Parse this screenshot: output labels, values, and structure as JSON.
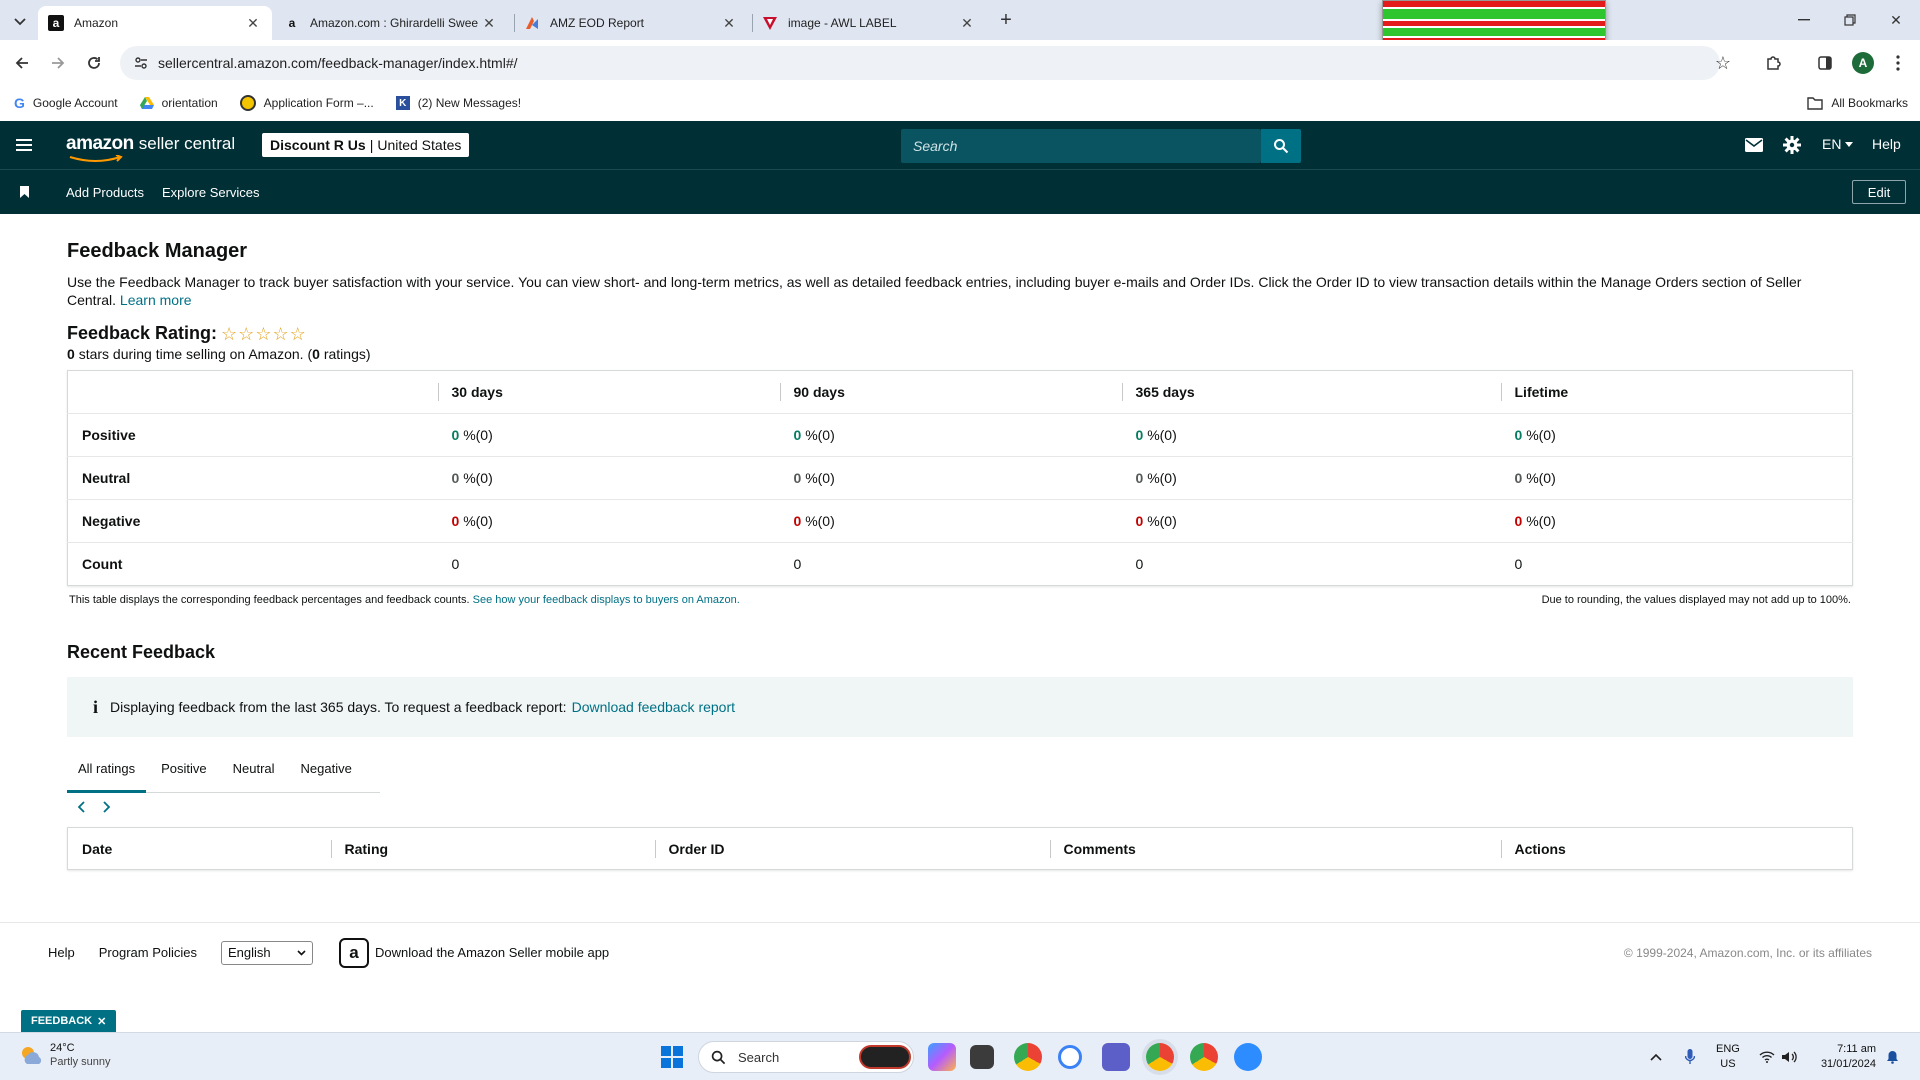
{
  "browser": {
    "tabs": [
      {
        "title": "Amazon",
        "active": true
      },
      {
        "title": "Amazon.com : Ghirardelli Swee"
      },
      {
        "title": "AMZ EOD Report"
      },
      {
        "title": "image - AWL LABEL"
      }
    ],
    "url": "sellercentral.amazon.com/feedback-manager/index.html#/",
    "bookmarks": [
      "Google Account",
      "orientation",
      "Application Form –...",
      "(2) New Messages!"
    ],
    "all_bookmarks": "All Bookmarks",
    "profile_initial": "A"
  },
  "header": {
    "logo_main": "amazon",
    "logo_sub": "seller central",
    "store_name": "Discount R Us",
    "store_region": "United States",
    "search_placeholder": "Search",
    "language": "EN",
    "help": "Help"
  },
  "nav": {
    "add_products": "Add Products",
    "explore_services": "Explore Services",
    "edit": "Edit"
  },
  "page": {
    "title": "Feedback Manager",
    "description": "Use the Feedback Manager to track buyer satisfaction with your service. You can view short- and long-term metrics, as well as detailed feedback entries, including buyer e-mails and Order IDs. Click the Order ID to view transaction details within the Manage Orders section of Seller Central.",
    "learn_more": "Learn more",
    "rating_label": "Feedback Rating:",
    "stars_count": "0",
    "stars_text": "stars during time selling on Amazon. (",
    "ratings_count": "0",
    "ratings_text": "ratings)"
  },
  "metrics": {
    "columns": [
      "30 days",
      "90 days",
      "365 days",
      "Lifetime"
    ],
    "rows": [
      {
        "label": "Positive",
        "values": [
          "0",
          "0",
          "0",
          "0"
        ],
        "suffix": "%(0)"
      },
      {
        "label": "Neutral",
        "values": [
          "0",
          "0",
          "0",
          "0"
        ],
        "suffix": "%(0)"
      },
      {
        "label": "Negative",
        "values": [
          "0",
          "0",
          "0",
          "0"
        ],
        "suffix": "%(0)"
      },
      {
        "label": "Count",
        "values": [
          "0",
          "0",
          "0",
          "0"
        ]
      }
    ],
    "note_left": "This table displays the corresponding feedback percentages and feedback counts.",
    "note_link": "See how your feedback displays to buyers on Amazon.",
    "note_right": "Due to rounding, the values displayed may not add up to 100%."
  },
  "recent": {
    "title": "Recent Feedback",
    "info_text": "Displaying feedback from the last 365 days. To request a feedback report:",
    "info_link": "Download feedback report",
    "tabs": [
      "All ratings",
      "Positive",
      "Neutral",
      "Negative"
    ],
    "columns": [
      "Date",
      "Rating",
      "Order ID",
      "Comments",
      "Actions"
    ]
  },
  "footer": {
    "help": "Help",
    "policies": "Program Policies",
    "language": "English",
    "app": "Download the Amazon Seller mobile app",
    "copyright": "© 1999-2024, Amazon.com, Inc. or its affiliates",
    "feedback_pill": "FEEDBACK"
  },
  "taskbar": {
    "temp": "24°C",
    "weather": "Partly sunny",
    "search": "Search",
    "lang1": "ENG",
    "lang2": "US",
    "time": "7:11 am",
    "date": "31/01/2024"
  },
  "colors": {
    "header_bg": "#002f36",
    "link": "#007185",
    "positive": "#067d62",
    "negative": "#c40000"
  }
}
